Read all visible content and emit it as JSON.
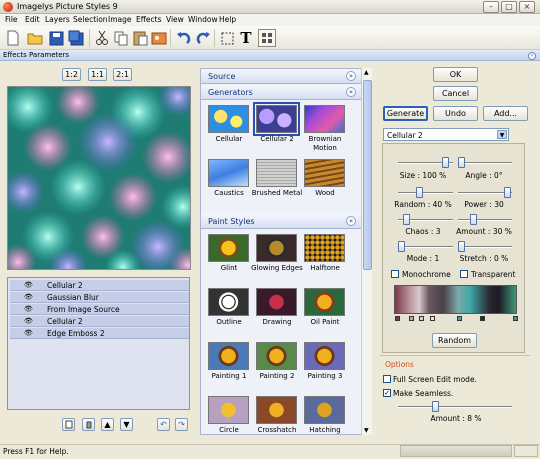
{
  "window": {
    "title": "Imagelys Picture Styles 9"
  },
  "menu": [
    "File",
    "Edit",
    "Layers",
    "Selection",
    "Image",
    "Effects",
    "View",
    "Window",
    "Help"
  ],
  "toolbar": {
    "icons": [
      "new-document-icon",
      "open-folder-icon",
      "save-icon",
      "save-as-icon",
      "cut-icon",
      "copy-icon",
      "paste-icon",
      "import-image-icon",
      "undo-icon",
      "redo-icon",
      "select-rectangle-icon",
      "text-tool-icon",
      "layout-icon"
    ]
  },
  "panel": {
    "title": "Effects Parameters"
  },
  "zoom": {
    "half": "1:2",
    "one": "1:1",
    "double": "2:1"
  },
  "effects_list": [
    "Cellular 2",
    "Gaussian Blur",
    "From Image Source",
    "Cellular 2",
    "Edge Emboss 2"
  ],
  "categories": {
    "source": "Source",
    "generators": {
      "title": "Generators",
      "items": [
        {
          "label": "Cellular",
          "selected": false
        },
        {
          "label": "Cellular 2",
          "selected": true
        },
        {
          "label": "Brownian Motion",
          "selected": false
        },
        {
          "label": "Caustics",
          "selected": false
        },
        {
          "label": "Brushed Metal",
          "selected": false
        },
        {
          "label": "Wood",
          "selected": false
        }
      ]
    },
    "paint_styles": {
      "title": "Paint Styles",
      "items": [
        "Glint",
        "Glowing Edges",
        "Halftone",
        "Outline",
        "Drawing",
        "Oil Paint",
        "Painting 1",
        "Painting 2",
        "Painting 3",
        "Circle",
        "Crosshatch",
        "Hatching"
      ]
    }
  },
  "buttons": {
    "ok": "OK",
    "cancel": "Cancel",
    "generate": "Generate",
    "undo": "Undo",
    "add": "Add..."
  },
  "effect_select": {
    "value": "Cellular 2"
  },
  "params": {
    "size": "Size : 100 %",
    "angle": "Angle : 0°",
    "random": "Random : 40 %",
    "power": "Power : 30",
    "chaos": "Chaos : 3",
    "amount": "Amount : 30 %",
    "mode": "Mode : 1",
    "stretch": "Stretch : 0 %",
    "monochrome": "Monochrome",
    "transparent": "Transparent",
    "random_button": "Random"
  },
  "options": {
    "title": "Options",
    "fullscreen": "Full Screen Edit mode.",
    "seamless": "Make Seamless.",
    "seamless_checked": true,
    "amount": "Amount : 8 %"
  },
  "status": {
    "text": "Press F1 for Help."
  },
  "colors": {
    "accent": "#15357a",
    "selection_bg": "#c6cde6"
  }
}
